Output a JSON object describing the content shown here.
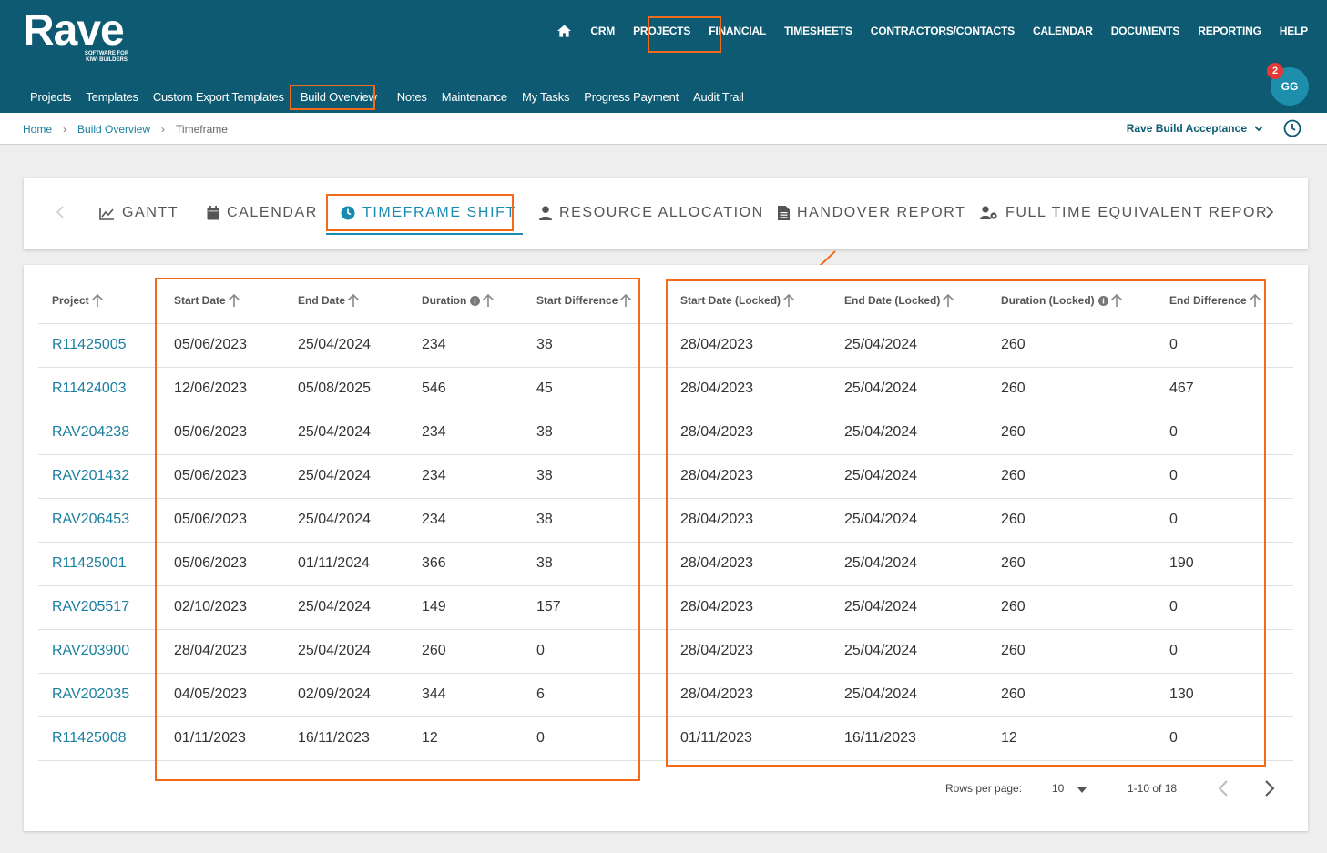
{
  "app": {
    "logo_text": "Rave",
    "logo_tagline_1": "SOFTWARE FOR",
    "logo_tagline_2": "KIWI BUILDERS"
  },
  "topnav": [
    "CRM",
    "PROJECTS",
    "FINANCIAL",
    "TIMESHEETS",
    "CONTRACTORS/CONTACTS",
    "CALENDAR",
    "DOCUMENTS",
    "REPORTING",
    "HELP"
  ],
  "subnav": [
    "Projects",
    "Templates",
    "Custom Export Templates",
    "Build Overview",
    "Notes",
    "Maintenance",
    "My Tasks",
    "Progress Payment",
    "Audit Trail"
  ],
  "user": {
    "initials": "GG",
    "notifications": "2"
  },
  "breadcrumb": {
    "home": "Home",
    "section": "Build Overview",
    "current": "Timeframe",
    "separator": "›"
  },
  "company": "Rave Build Acceptance",
  "tabs": [
    "GANTT",
    "CALENDAR",
    "TIMEFRAME SHIFT",
    "RESOURCE ALLOCATION",
    "HANDOVER REPORT",
    "FULL TIME EQUIVALENT REPOR"
  ],
  "active_tab": "TIMEFRAME SHIFT",
  "table": {
    "columns": [
      "Project",
      "Start Date",
      "End Date",
      "Duration",
      "Start Difference",
      "Start Date (Locked)",
      "End Date (Locked)",
      "Duration (Locked)",
      "End Difference"
    ],
    "rows": [
      [
        "R11425005",
        "05/06/2023",
        "25/04/2024",
        "234",
        "38",
        "28/04/2023",
        "25/04/2024",
        "260",
        "0"
      ],
      [
        "R11424003",
        "12/06/2023",
        "05/08/2025",
        "546",
        "45",
        "28/04/2023",
        "25/04/2024",
        "260",
        "467"
      ],
      [
        "RAV204238",
        "05/06/2023",
        "25/04/2024",
        "234",
        "38",
        "28/04/2023",
        "25/04/2024",
        "260",
        "0"
      ],
      [
        "RAV201432",
        "05/06/2023",
        "25/04/2024",
        "234",
        "38",
        "28/04/2023",
        "25/04/2024",
        "260",
        "0"
      ],
      [
        "RAV206453",
        "05/06/2023",
        "25/04/2024",
        "234",
        "38",
        "28/04/2023",
        "25/04/2024",
        "260",
        "0"
      ],
      [
        "R11425001",
        "05/06/2023",
        "01/11/2024",
        "366",
        "38",
        "28/04/2023",
        "25/04/2024",
        "260",
        "190"
      ],
      [
        "RAV205517",
        "02/10/2023",
        "25/04/2024",
        "149",
        "157",
        "28/04/2023",
        "25/04/2024",
        "260",
        "0"
      ],
      [
        "RAV203900",
        "28/04/2023",
        "25/04/2024",
        "260",
        "0",
        "28/04/2023",
        "25/04/2024",
        "260",
        "0"
      ],
      [
        "RAV202035",
        "04/05/2023",
        "02/09/2024",
        "344",
        "6",
        "28/04/2023",
        "25/04/2024",
        "260",
        "130"
      ],
      [
        "R11425008",
        "01/11/2023",
        "16/11/2023",
        "12",
        "0",
        "01/11/2023",
        "16/11/2023",
        "12",
        "0"
      ]
    ]
  },
  "pagination": {
    "rows_per_page_label": "Rows per page:",
    "rows_per_page": "10",
    "range": "1-10 of 18"
  },
  "colors": {
    "header_bg": "#0e5a72",
    "accent": "#1a8bb0",
    "highlight": "#f26b1d",
    "link": "#1a7fa0"
  }
}
